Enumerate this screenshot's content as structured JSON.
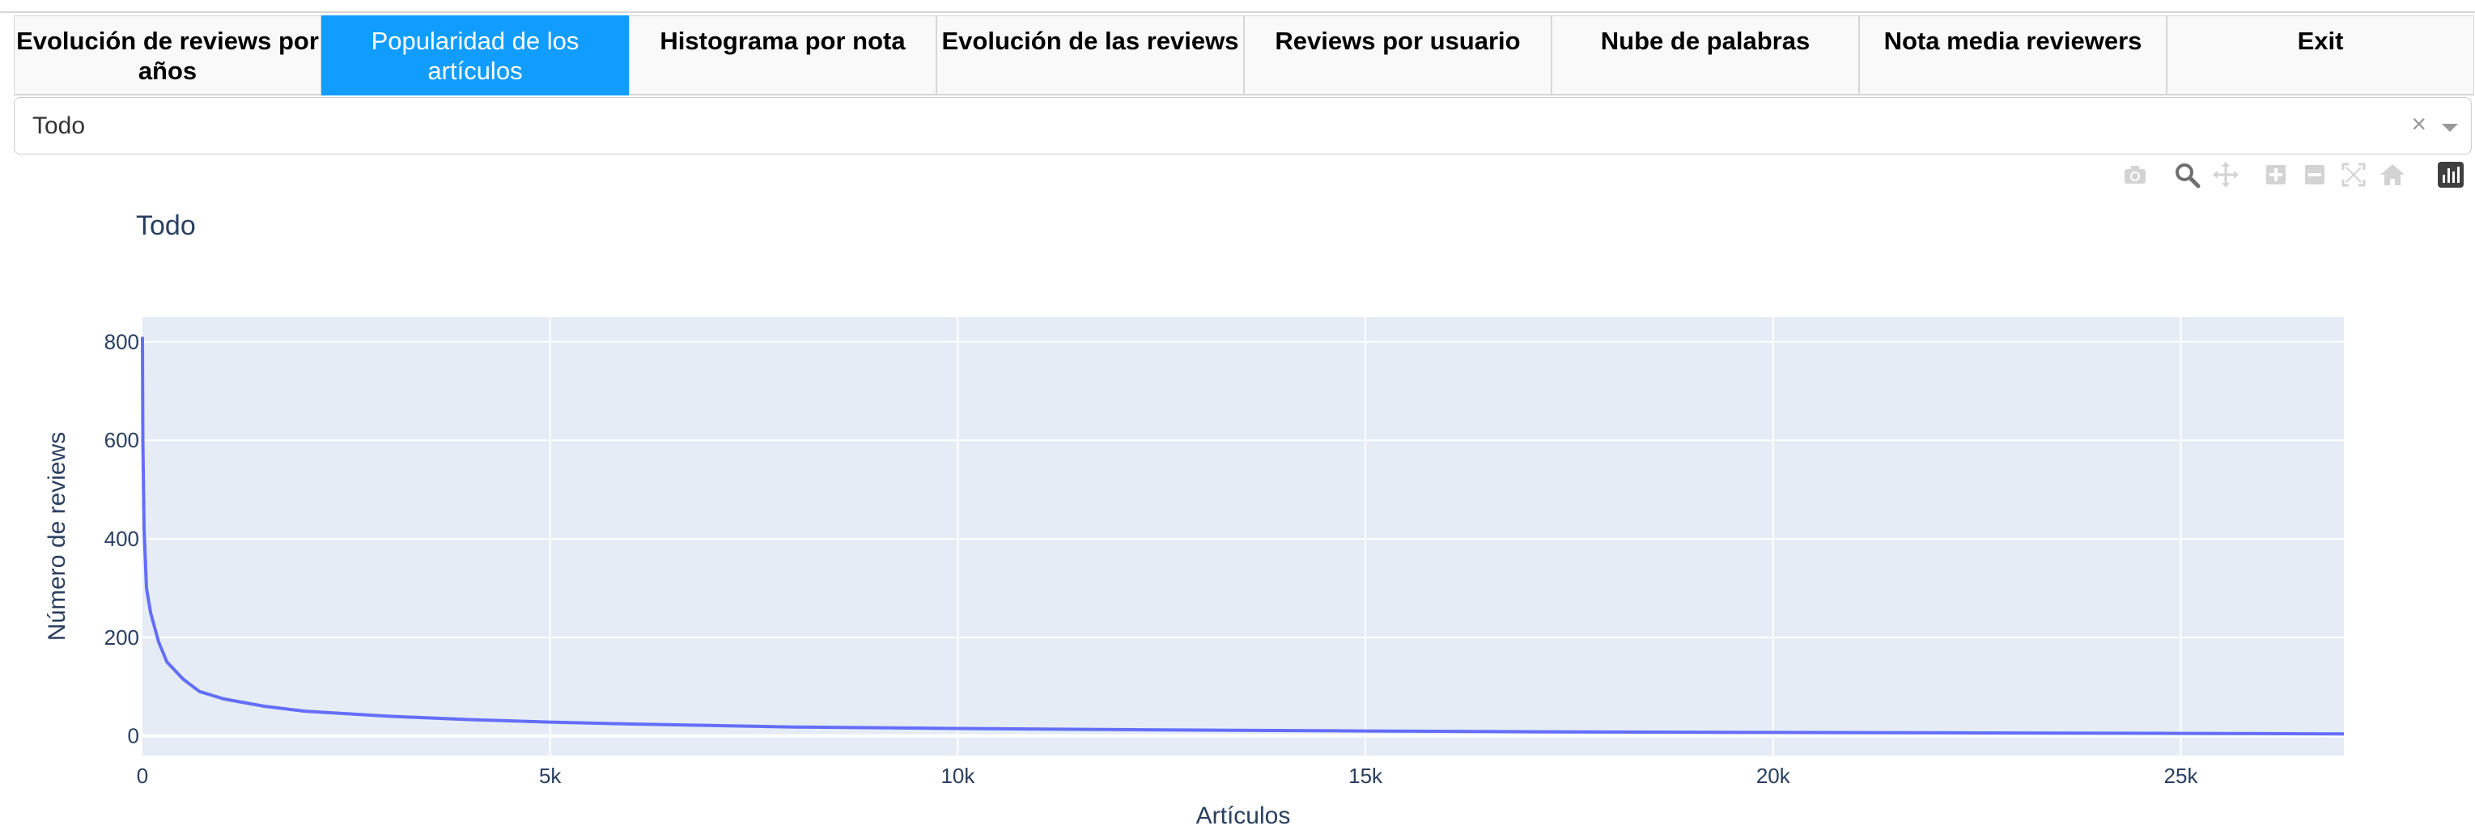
{
  "tabs": [
    {
      "label": "Evolución de reviews por años",
      "selected": false
    },
    {
      "label": "Popularidad de los artículos",
      "selected": true
    },
    {
      "label": "Histograma por nota",
      "selected": false
    },
    {
      "label": "Evolución de las reviews",
      "selected": false
    },
    {
      "label": "Reviews por usuario",
      "selected": false
    },
    {
      "label": "Nube de palabras",
      "selected": false
    },
    {
      "label": "Nota media reviewers",
      "selected": false
    },
    {
      "label": "Exit",
      "selected": false
    }
  ],
  "dropdown": {
    "value": "Todo",
    "clear_glyph": "×"
  },
  "modebar": {
    "icons": [
      "camera-icon",
      "zoom-icon",
      "pan-icon",
      "zoom-in-icon",
      "zoom-out-icon",
      "autoscale-icon",
      "reset-axes-icon",
      "plotly-logo-icon"
    ]
  },
  "colors": {
    "accent": "#119dff",
    "line": "#636efa",
    "plot_bg": "#e5ecf6",
    "axis_text": "#2a3f5f"
  },
  "chart_data": {
    "type": "line",
    "title": "Todo",
    "xlabel": "Artículos",
    "ylabel": "Número de reviews",
    "xlim": [
      0,
      27000
    ],
    "ylim": [
      -40,
      850
    ],
    "x_ticks": [
      {
        "v": 0,
        "label": "0"
      },
      {
        "v": 5000,
        "label": "5k"
      },
      {
        "v": 10000,
        "label": "10k"
      },
      {
        "v": 15000,
        "label": "15k"
      },
      {
        "v": 20000,
        "label": "20k"
      },
      {
        "v": 25000,
        "label": "25k"
      }
    ],
    "y_ticks": [
      {
        "v": 0,
        "label": "0"
      },
      {
        "v": 200,
        "label": "200"
      },
      {
        "v": 400,
        "label": "400"
      },
      {
        "v": 600,
        "label": "600"
      },
      {
        "v": 800,
        "label": "800"
      }
    ],
    "grid": true,
    "series": [
      {
        "x": [
          0,
          5,
          20,
          50,
          100,
          200,
          300,
          500,
          700,
          1000,
          1500,
          2000,
          3000,
          4000,
          5000,
          6000,
          8000,
          10000,
          12500,
          15000,
          17500,
          20000,
          22500,
          25000,
          27000
        ],
        "y": [
          810,
          600,
          420,
          300,
          250,
          190,
          150,
          115,
          90,
          75,
          60,
          50,
          40,
          33,
          28,
          24,
          18,
          15,
          12,
          10,
          8,
          7,
          6,
          5,
          4
        ]
      }
    ]
  }
}
